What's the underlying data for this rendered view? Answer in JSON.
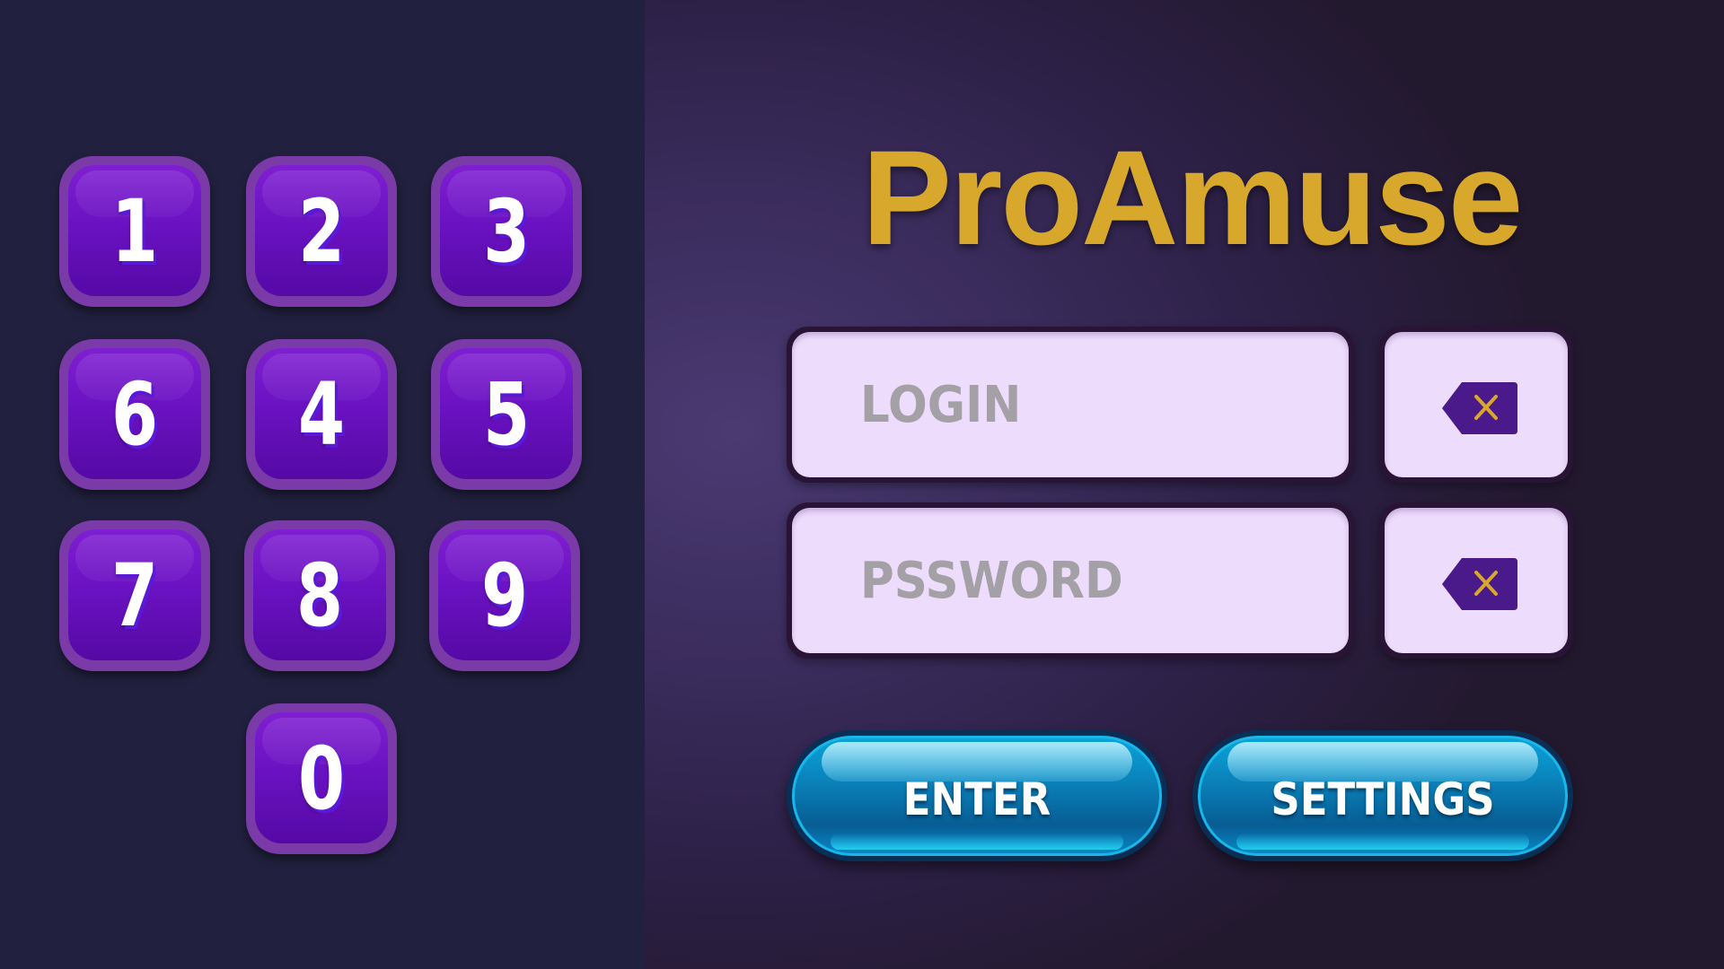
{
  "app": {
    "title": "ProAmuse"
  },
  "keypad": {
    "keys": [
      "1",
      "2",
      "3",
      "6",
      "4",
      "5",
      "7",
      "8",
      "9",
      "0"
    ]
  },
  "form": {
    "login_placeholder": "LOGIN",
    "password_placeholder": "PSSWORD",
    "clear_icon": "backspace-icon"
  },
  "actions": {
    "enter_label": "ENTER",
    "settings_label": "SETTINGS"
  },
  "colors": {
    "title": "#d8a82c",
    "key": "#6a12c2",
    "field": "#eedcfd",
    "button": "#0a7fb8"
  }
}
